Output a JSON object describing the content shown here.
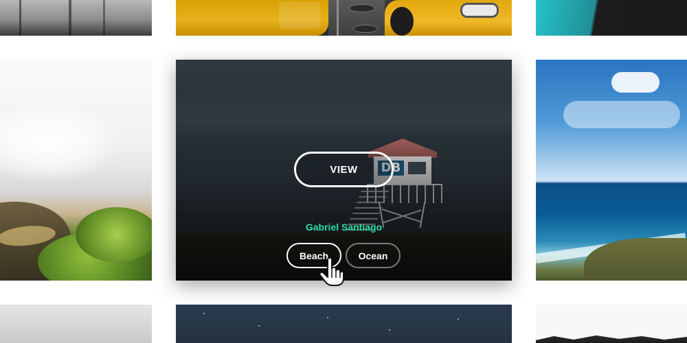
{
  "overlay": {
    "view_label": "VIEW",
    "author": "Gabriel Santiago",
    "tags": [
      "Beach",
      "Ocean"
    ]
  },
  "tower_badge": "DB"
}
